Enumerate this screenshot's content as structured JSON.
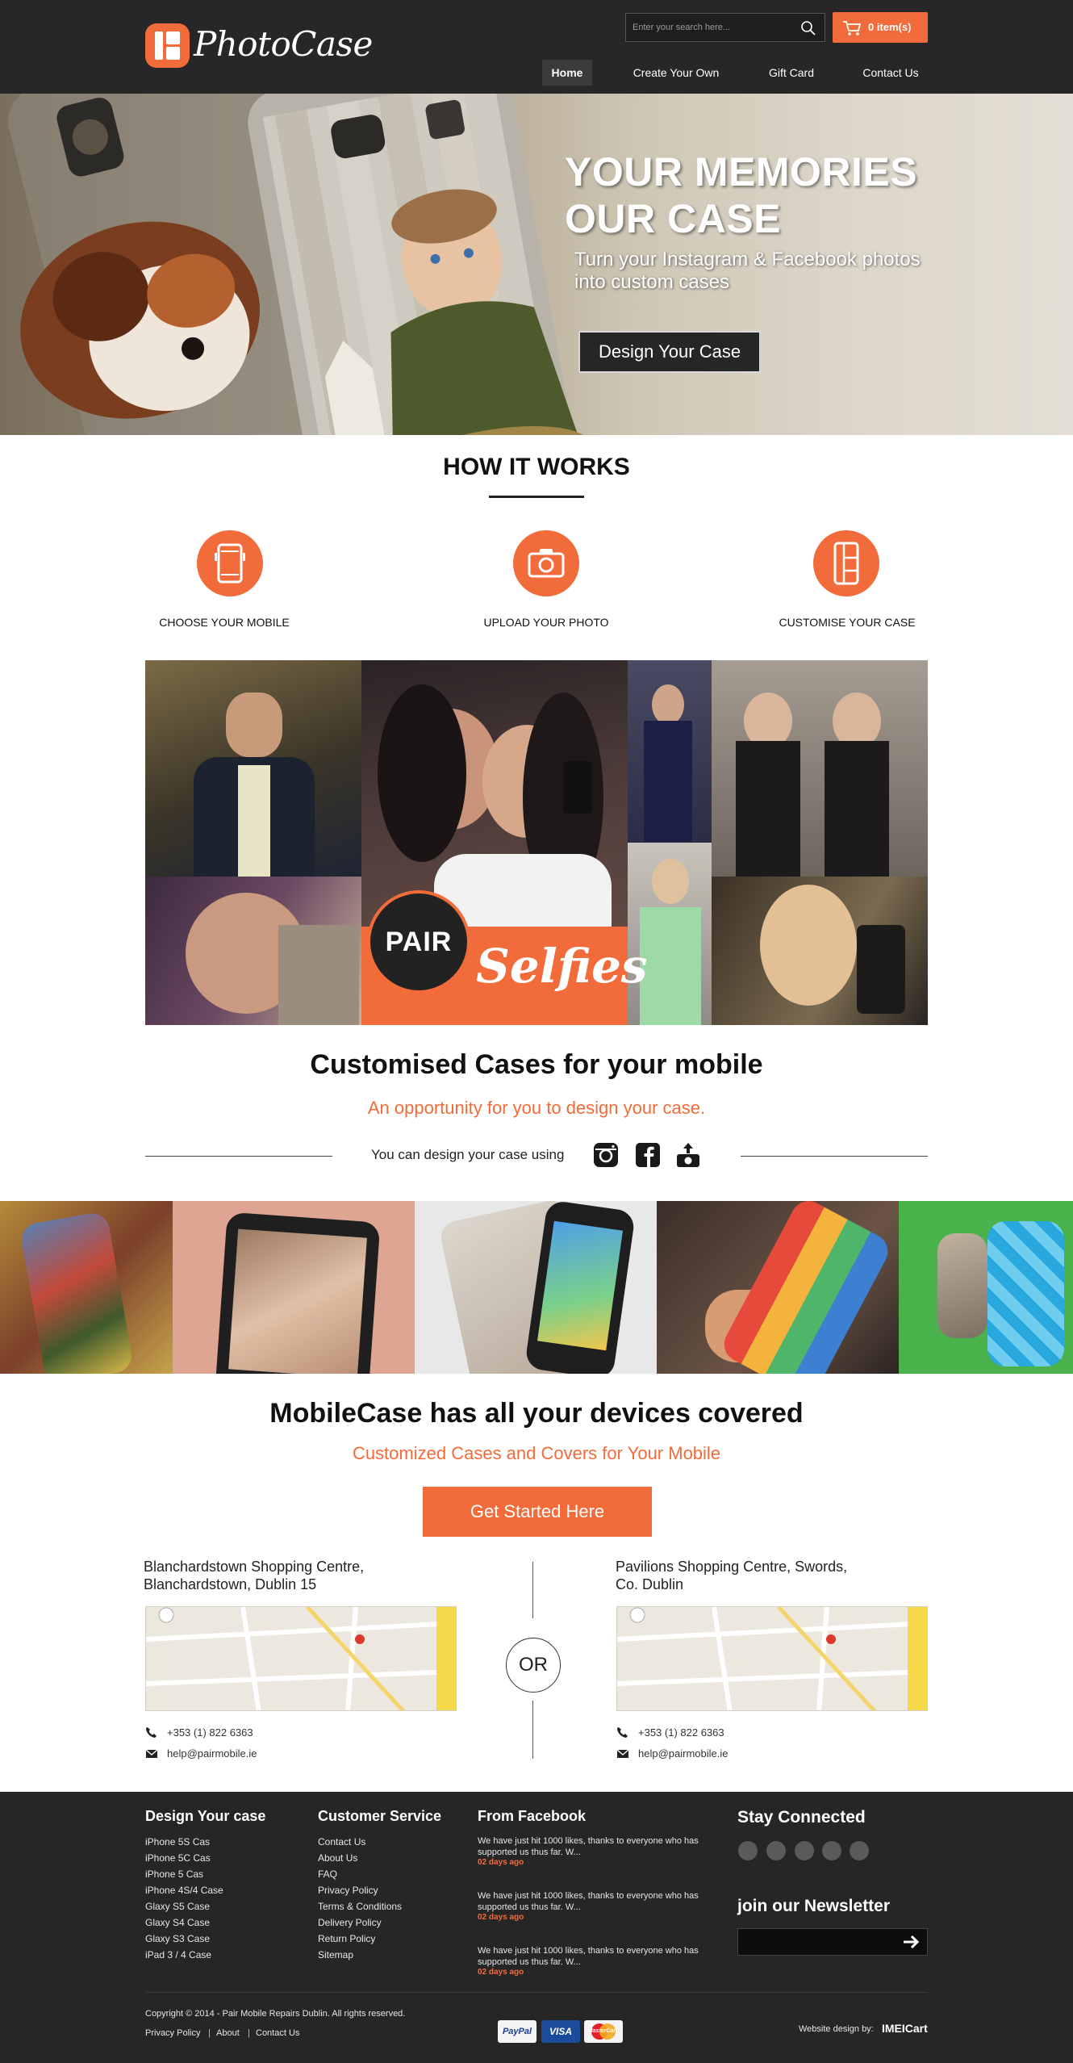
{
  "brand": {
    "logo_text": "PhotoCase"
  },
  "header": {
    "search_placeholder": "Enter your search here...",
    "cart_label": "0 item(s)",
    "nav": [
      "Home",
      "Create Your Own",
      "Gift Card",
      "Contact Us"
    ]
  },
  "hero": {
    "title_line1": "YOUR MEMORIES",
    "title_line2": "OUR  CASE",
    "subtitle": "Turn your Instagram & Facebook photos into custom cases",
    "cta": "Design Your Case"
  },
  "how_it_works": {
    "title": "HOW IT WORKS",
    "steps": [
      "CHOOSE YOUR MOBILE",
      "UPLOAD YOUR PHOTO",
      "CUSTOMISE YOUR CASE"
    ],
    "icons": [
      "phone-icon",
      "camera-icon",
      "case-icon"
    ]
  },
  "collage": {
    "badge": "PAIR",
    "banner": "Selfies"
  },
  "customised": {
    "title": "Customised Cases for your mobile",
    "subtitle": "An opportunity for you to design your case.",
    "design_using": "You can design your case using",
    "icons": [
      "instagram-icon",
      "facebook-icon",
      "upload-photo-icon"
    ]
  },
  "devices": {
    "title": "MobileCase has all your devices covered",
    "subtitle": "Customized Cases and Covers for Your Mobile",
    "cta": "Get Started Here"
  },
  "locations": {
    "left": {
      "line1": "Blanchardstown Shopping Centre,",
      "line2": "Blanchardstown,  Dublin 15",
      "phone": "+353 (1) 822 6363",
      "email": "help@pairmobile.ie"
    },
    "or": "OR",
    "right": {
      "line1": "Pavilions Shopping Centre,  Swords,",
      "line2": "Co. Dublin",
      "phone": "+353 (1) 822 6363",
      "email": "help@pairmobile.ie"
    }
  },
  "footer": {
    "design_head": "Design Your case",
    "design_links": [
      "iPhone 5S Cas",
      "iPhone 5C Cas",
      "iPhone 5 Cas",
      "iPhone 4S/4 Case",
      "Glaxy S5 Case",
      "Glaxy S4 Case",
      "Glaxy S3 Case",
      "iPad 3 / 4 Case"
    ],
    "service_head": "Customer Service",
    "service_links": [
      "Contact Us",
      "About Us",
      "FAQ",
      "Privacy Policy",
      "Terms & Conditions",
      "Delivery Policy",
      "Return Policy",
      "Sitemap"
    ],
    "fb_head": "From Facebook",
    "fb_posts": [
      {
        "text": "We have just hit 1000 likes, thanks to everyone who has supported us thus far. W...",
        "date": "02 days ago"
      },
      {
        "text": "We have just hit 1000 likes, thanks to everyone who has supported us thus far. W...",
        "date": "02 days ago"
      },
      {
        "text": "We have just hit 1000 likes, thanks to everyone who has supported us thus far. W...",
        "date": "02 days ago"
      }
    ],
    "stay_head": "Stay Connected",
    "newsletter_head": "join our Newsletter",
    "copyright": "Copyright © 2014 - Pair Mobile Repairs Dublin. All rights reserved.",
    "legal_links": [
      "Privacy Policy",
      "About",
      "Contact Us"
    ],
    "legal_sep": "|",
    "payments": [
      "PayPal",
      "VISA",
      "MasterCard"
    ],
    "design_by": "Website design by:",
    "design_by_brand": "IMEICart"
  },
  "colors": {
    "accent": "#f26b3a",
    "header_bg": "#272727",
    "footer_bg": "#262626"
  }
}
